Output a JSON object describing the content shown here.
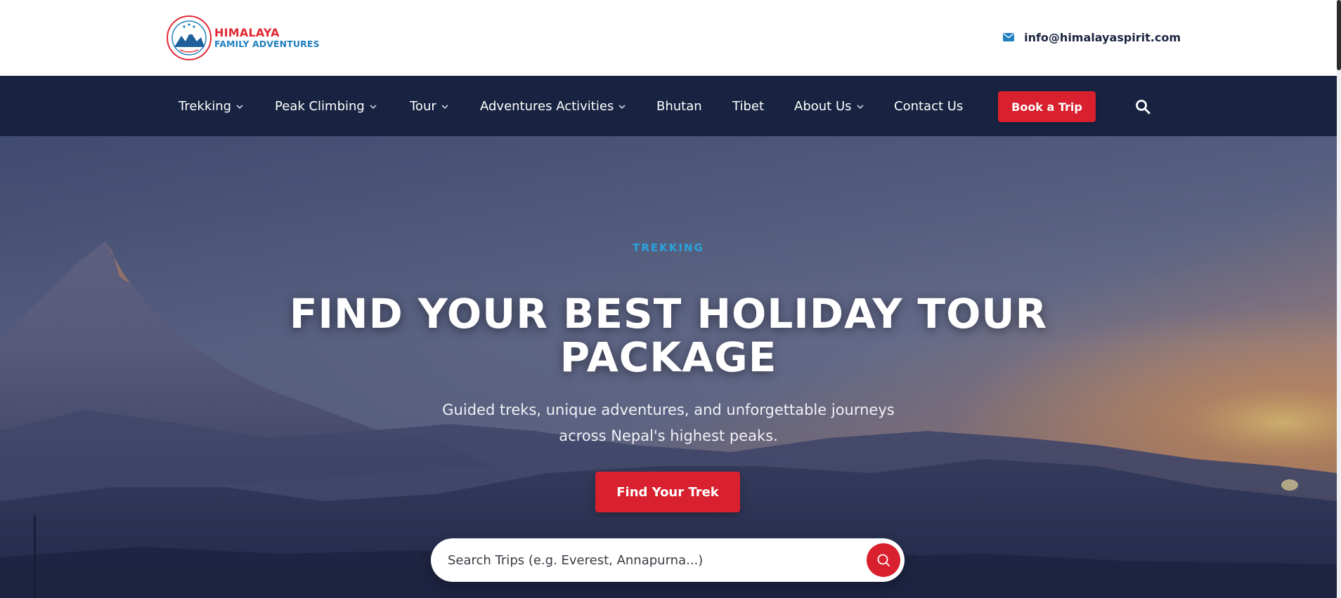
{
  "brand": {
    "name_line1": "HIMALAYA",
    "name_line2": "FAMILY ADVENTURES",
    "primary_color": "#e02a35",
    "secondary_color": "#1f7fbf"
  },
  "header": {
    "email": "info@himalayaspirit.com",
    "email_icon": "envelope-icon"
  },
  "nav": {
    "items": [
      {
        "label": "Trekking",
        "has_dropdown": true
      },
      {
        "label": "Peak Climbing",
        "has_dropdown": true
      },
      {
        "label": "Tour",
        "has_dropdown": true
      },
      {
        "label": "Adventures Activities",
        "has_dropdown": true
      },
      {
        "label": "Bhutan",
        "has_dropdown": false
      },
      {
        "label": "Tibet",
        "has_dropdown": false
      },
      {
        "label": "About Us",
        "has_dropdown": true
      },
      {
        "label": "Contact Us",
        "has_dropdown": false
      }
    ],
    "book_label": "Book a Trip",
    "search_icon": "search-icon",
    "background_color": "#172340"
  },
  "hero": {
    "eyebrow": "TREKKING",
    "title_line1": "FIND YOUR BEST HOLIDAY TOUR",
    "title_line2": "PACKAGE",
    "subtitle_line1": "Guided treks, unique adventures, and unforgettable journeys",
    "subtitle_line2": "across Nepal's highest peaks.",
    "cta_label": "Find Your Trek",
    "accent_color": "#d8202e"
  },
  "search": {
    "placeholder": "Search Trips (e.g. Everest, Annapurna...)",
    "value": "",
    "button_icon": "search-icon"
  }
}
